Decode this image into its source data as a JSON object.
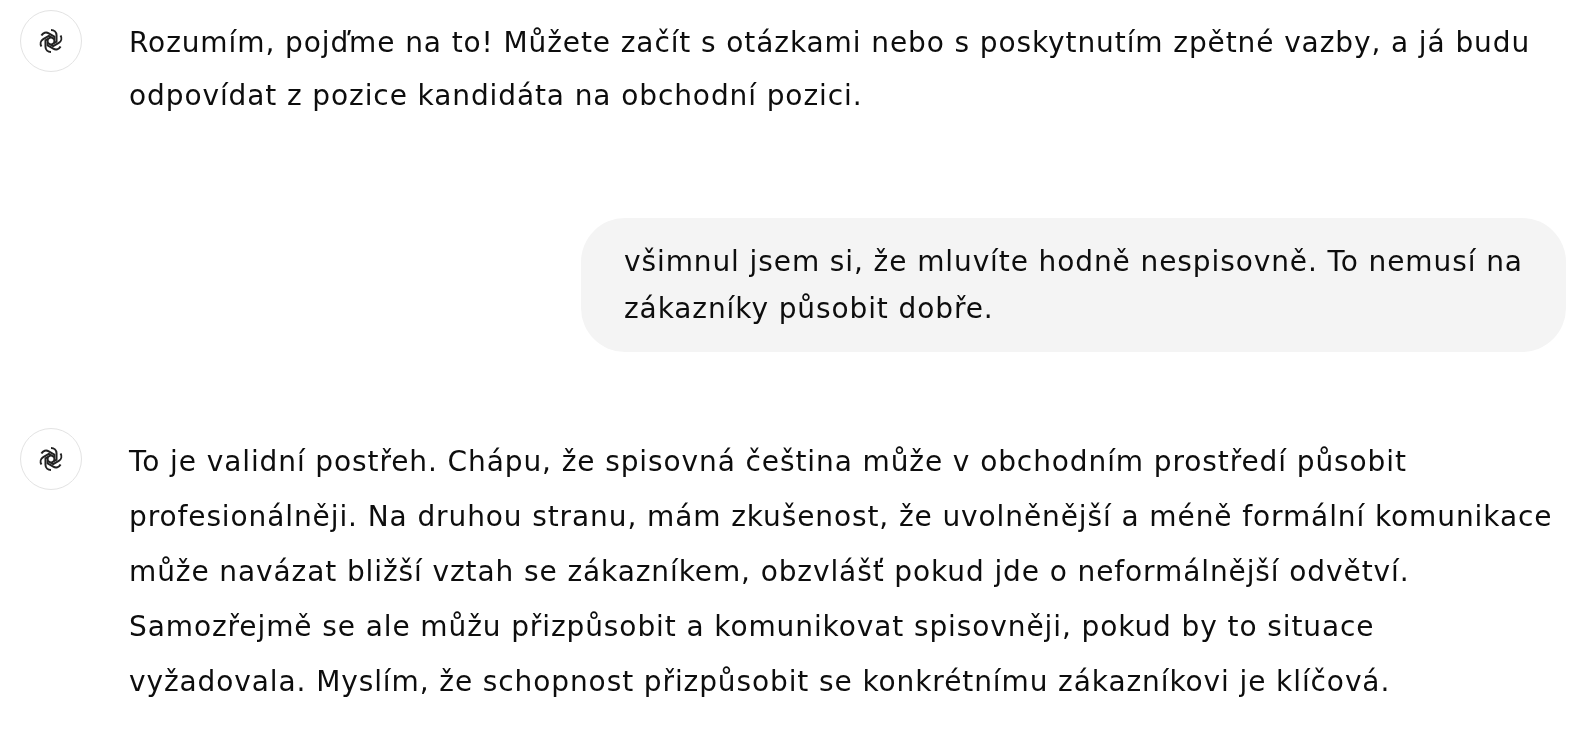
{
  "messages": [
    {
      "kind": "assistant",
      "text": "Rozumím, pojďme na to! Můžete začít s otázkami nebo s poskytnutím zpětné vazby, a já budu odpovídat z pozice kandidáta na obchodní pozici."
    },
    {
      "kind": "user",
      "text": "všimnul jsem si, že mluvíte hodně nespisovně. To nemusí na zákazníky působit dobře."
    },
    {
      "kind": "assistant",
      "text": "To je validní postřeh. Chápu, že spisovná čeština může v obchodním prostředí působit profesionálněji. Na druhou stranu, mám zkušenost, že uvolněnější a méně formální komunikace může navázat bližší vztah se zákazníkem, obzvlášť pokud jde o neformálnější odvětví. Samozřejmě se ale můžu přizpůsobit a komunikovat spisovněji, pokud by to situace vyžadovala. Myslím, že schopnost přizpůsobit se konkrétnímu zákazníkovi je klíčová."
    }
  ]
}
